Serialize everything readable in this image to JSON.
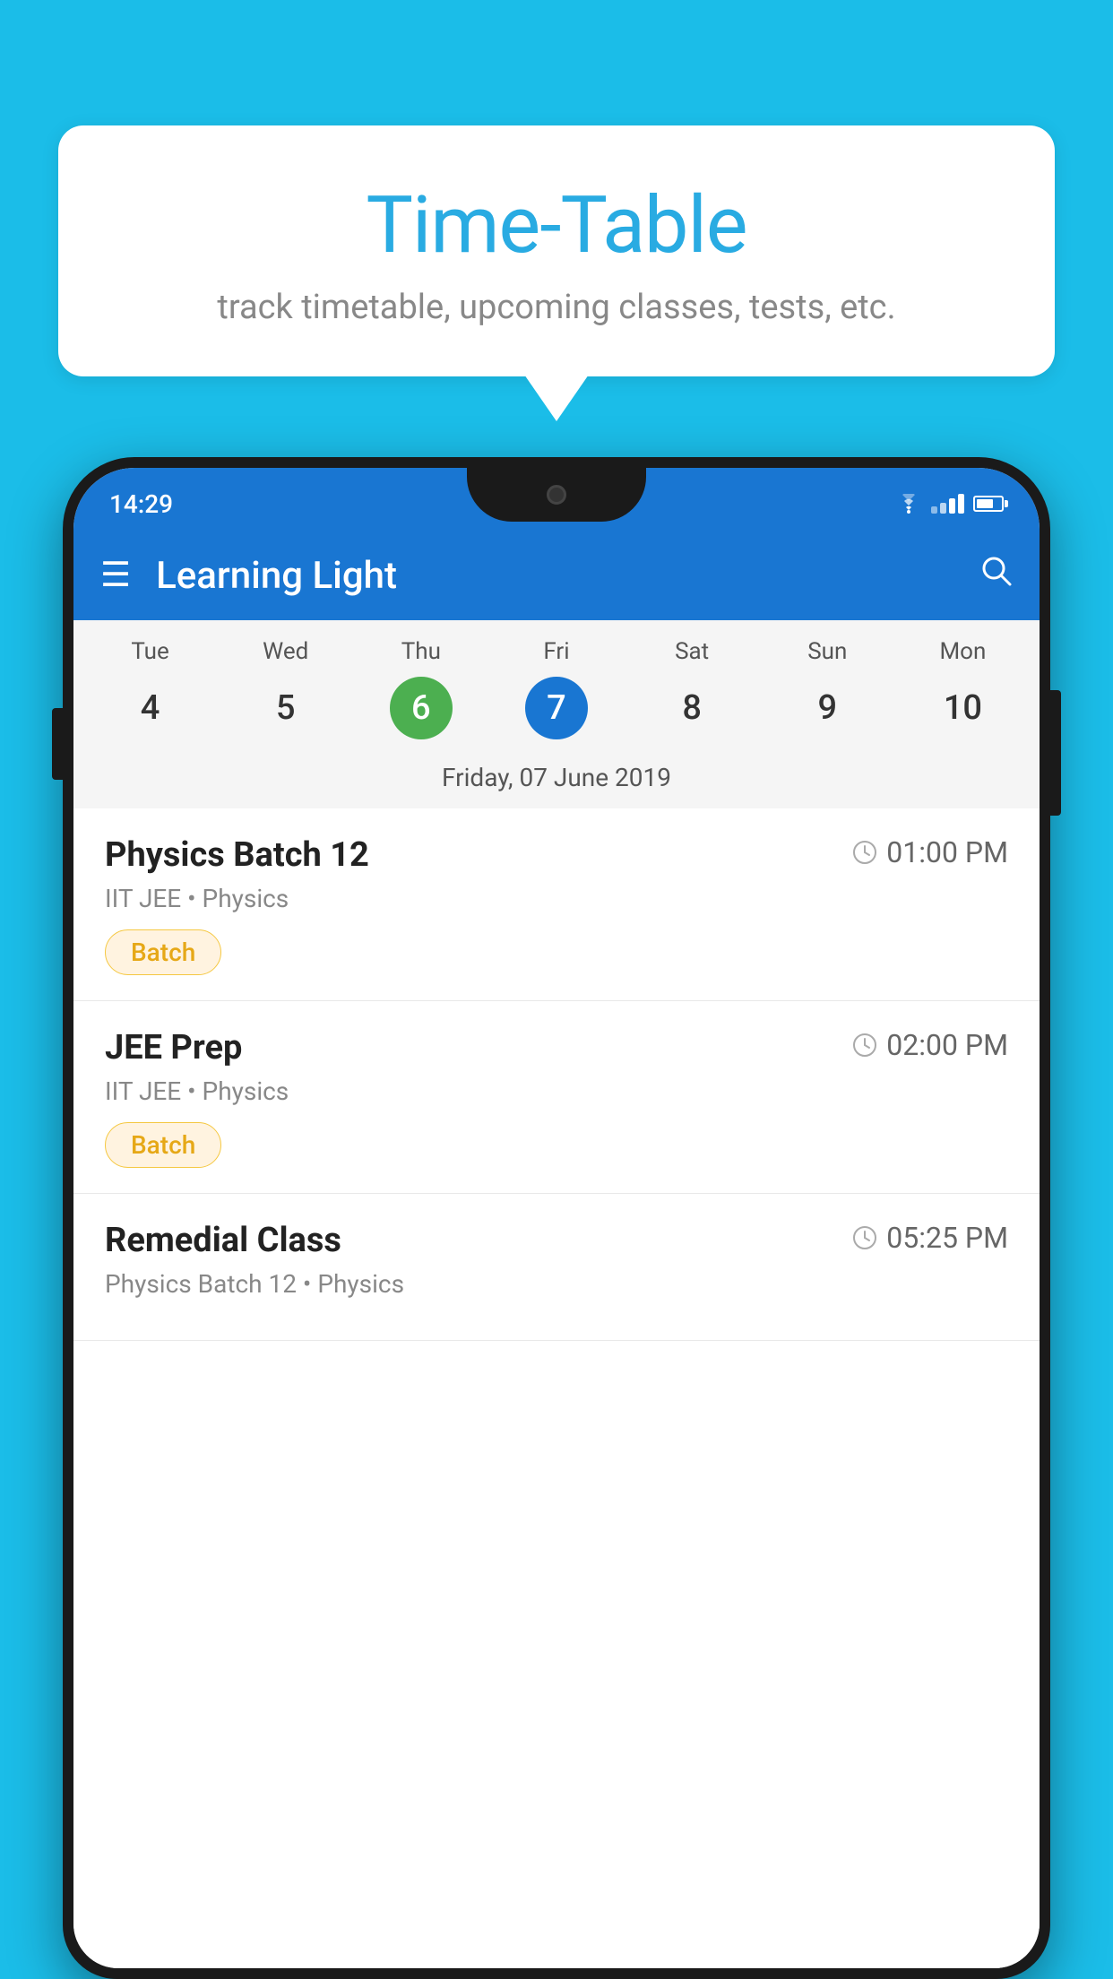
{
  "background_color": "#1BBDE8",
  "speech_bubble": {
    "title": "Time-Table",
    "subtitle": "track timetable, upcoming classes, tests, etc."
  },
  "status_bar": {
    "time": "14:29"
  },
  "app_bar": {
    "title": "Learning Light",
    "hamburger_label": "☰",
    "search_label": "🔍"
  },
  "calendar": {
    "days": [
      {
        "name": "Tue",
        "number": "4"
      },
      {
        "name": "Wed",
        "number": "5"
      },
      {
        "name": "Thu",
        "number": "6",
        "state": "today"
      },
      {
        "name": "Fri",
        "number": "7",
        "state": "selected"
      },
      {
        "name": "Sat",
        "number": "8"
      },
      {
        "name": "Sun",
        "number": "9"
      },
      {
        "name": "Mon",
        "number": "10"
      }
    ],
    "selected_date_label": "Friday, 07 June 2019"
  },
  "schedule_items": [
    {
      "title": "Physics Batch 12",
      "time": "01:00 PM",
      "subtitle": "IIT JEE • Physics",
      "tag": "Batch"
    },
    {
      "title": "JEE Prep",
      "time": "02:00 PM",
      "subtitle": "IIT JEE • Physics",
      "tag": "Batch"
    },
    {
      "title": "Remedial Class",
      "time": "05:25 PM",
      "subtitle": "Physics Batch 12 • Physics",
      "tag": ""
    }
  ]
}
